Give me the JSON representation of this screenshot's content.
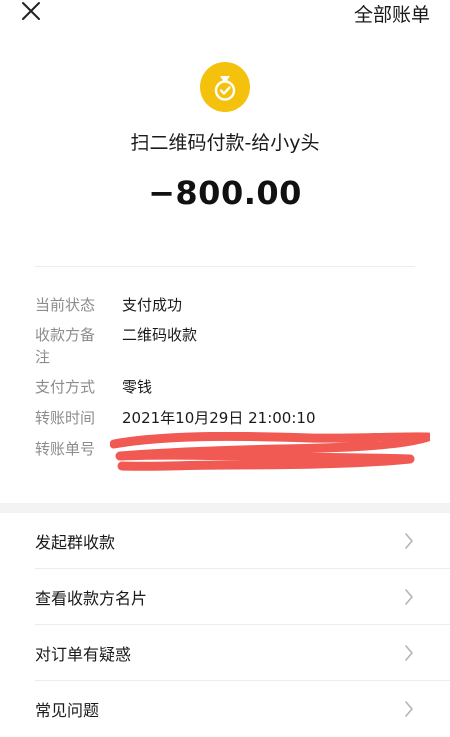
{
  "header": {
    "close_icon": "close-icon",
    "all_bills": "全部账单"
  },
  "summary": {
    "status_icon": "coin-bag-check-icon",
    "title": "扫二维码付款-给小y头",
    "amount": "−800.00",
    "accent_color": "#f4c20d"
  },
  "details": {
    "status_label": "当前状态",
    "status_value": "支付成功",
    "payee_note_label": "收款方备注",
    "payee_note_value": "二维码收款",
    "method_label": "支付方式",
    "method_value": "零钱",
    "time_label": "转账时间",
    "time_value": "2021年10月29日 21:00:10",
    "order_no_label": "转账单号"
  },
  "redaction_color": "#f05a52",
  "menu": {
    "items": [
      {
        "label": "发起群收款"
      },
      {
        "label": "查看收款方名片"
      },
      {
        "label": "对订单有疑惑"
      },
      {
        "label": "常见问题"
      }
    ]
  }
}
